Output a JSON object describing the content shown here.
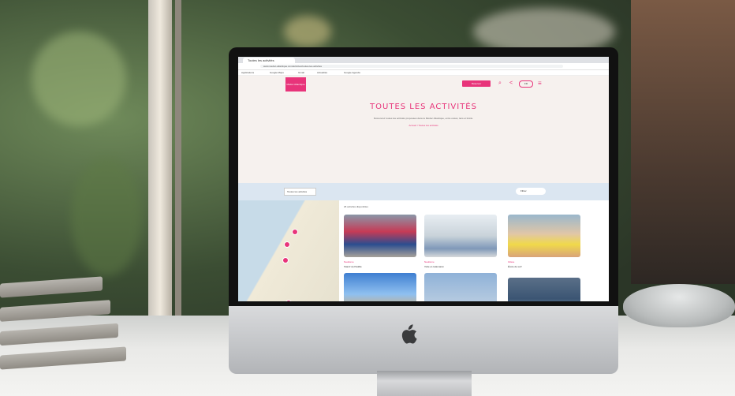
{
  "browser": {
    "tab_title": "Toutes les activités",
    "url": "www.medoc-atlantique.com/activites/toutes-les-activites",
    "bookmarks": [
      "Applications",
      "Google Maps",
      "Gmail",
      "Actualités",
      "Google Agenda"
    ]
  },
  "site": {
    "logo_text": "Médoc Atlantique",
    "booking_label": "Réserver",
    "lang_label": "FR",
    "hero_title": "TOUTES LES ACTIVITÉS",
    "hero_text": "Découvrez toutes les activités proposées dans le Médoc Atlantique, entre océan, lacs et forêts.",
    "breadcrumb": "Accueil / Toutes les activités"
  },
  "filters": {
    "select_label": "Toutes les activités",
    "filter_label": "Filtrer"
  },
  "results": {
    "count_label": "26 activités disponibles"
  },
  "cards": [
    {
      "tag": "Nautisme",
      "title": "Stand Up Paddle"
    },
    {
      "tag": "Nautisme",
      "title": "Voile et catamaran"
    },
    {
      "tag": "Glisse",
      "title": "École de surf"
    }
  ],
  "colors": {
    "brand": "#e8347a",
    "hero_bg": "#f6f1ee",
    "filter_bar": "#dbe6f1"
  }
}
